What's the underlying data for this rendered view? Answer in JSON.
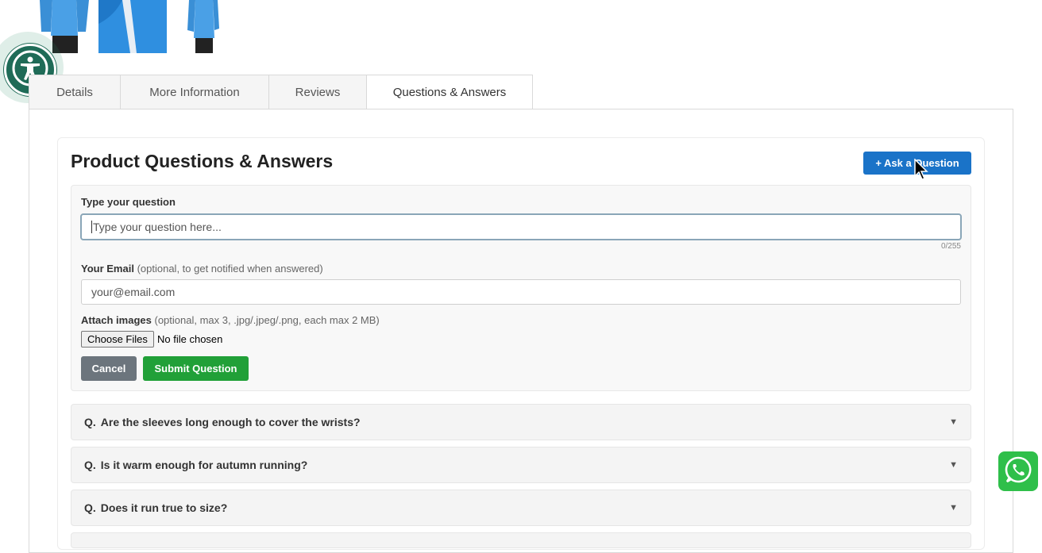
{
  "tabs": [
    {
      "label": "Details"
    },
    {
      "label": "More Information"
    },
    {
      "label": "Reviews"
    },
    {
      "label": "Questions & Answers"
    }
  ],
  "qa": {
    "title": "Product Questions & Answers",
    "ask_button": "+ Ask a Question",
    "form": {
      "question_label": "Type your question",
      "question_placeholder": "Type your question here...",
      "counter": "0/255",
      "email_label": "Your Email",
      "email_hint": "(optional, to get notified when answered)",
      "email_placeholder": "your@email.com",
      "attach_label": "Attach images",
      "attach_hint": "(optional, max 3, .jpg/.jpeg/.png, each max 2 MB)",
      "file_button": "Choose Files",
      "file_status": "No file chosen",
      "cancel": "Cancel",
      "submit": "Submit Question"
    },
    "questions": [
      {
        "prefix": "Q.",
        "text": "Are the sleeves long enough to cover the wrists?"
      },
      {
        "prefix": "Q.",
        "text": "Is it warm enough for autumn running?"
      },
      {
        "prefix": "Q.",
        "text": "Does it run true to size?"
      }
    ]
  },
  "colors": {
    "primary": "#1a73c8",
    "success": "#21a038",
    "secondary": "#6c757d",
    "whatsapp": "#2fbf4a",
    "accessibility": "#1f6b57"
  },
  "icons": [
    "accessibility-icon",
    "whatsapp-icon",
    "chevron-down-icon",
    "mouse-cursor-icon"
  ]
}
